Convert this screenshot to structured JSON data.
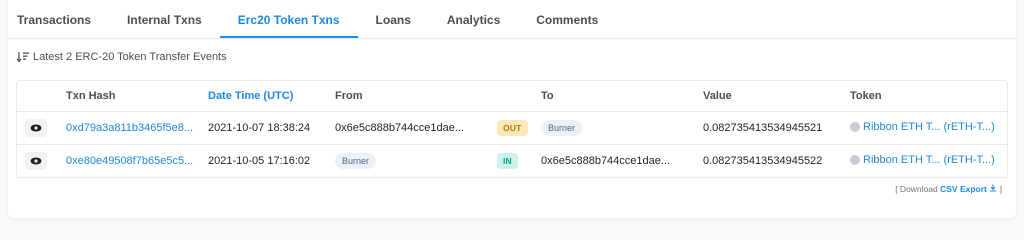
{
  "tabs": [
    {
      "label": "Transactions",
      "active": false
    },
    {
      "label": "Internal Txns",
      "active": false
    },
    {
      "label": "Erc20 Token Txns",
      "active": true
    },
    {
      "label": "Loans",
      "active": false
    },
    {
      "label": "Analytics",
      "active": false
    },
    {
      "label": "Comments",
      "active": false
    }
  ],
  "summary": "Latest 2 ERC-20 Token Transfer Events",
  "table": {
    "headers": {
      "txn_hash": "Txn Hash",
      "date_time": "Date Time (UTC)",
      "from": "From",
      "to": "To",
      "value": "Value",
      "token": "Token"
    },
    "rows": [
      {
        "txn_hash": "0xd79a3a811b3465f5e8...",
        "date_time": "2021-10-07 18:38:24",
        "from": "0x6e5c888b744cce1dae...",
        "direction": "OUT",
        "to": "Burner",
        "value": "0.082735413534945521",
        "token": "Ribbon ETH T... (rETH-T...)"
      },
      {
        "txn_hash": "0xe80e49508f7b65e5c5...",
        "date_time": "2021-10-05 17:16:02",
        "from": "Burner",
        "direction": "IN",
        "to": "0x6e5c888b744cce1dae...",
        "value": "0.082735413534945522",
        "token": "Ribbon ETH T... (rETH-T...)"
      }
    ]
  },
  "download": {
    "prefix": "[ Download",
    "link": "CSV Export",
    "suffix": "]"
  },
  "colors": {
    "accent": "#1e88e5",
    "out_badge": "#fbe8b9",
    "in_badge": "#cdf2ea"
  }
}
